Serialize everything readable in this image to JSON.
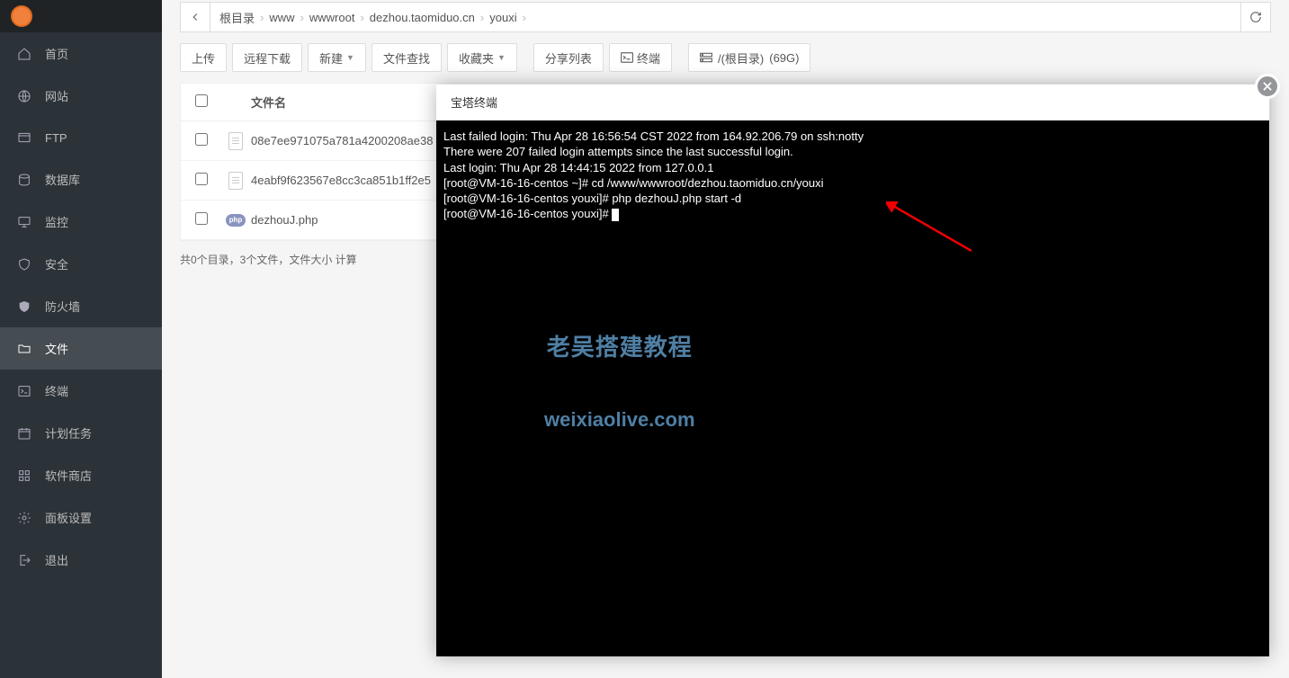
{
  "sidebar": {
    "server_name": "",
    "items": [
      {
        "label": "首页",
        "icon": "home"
      },
      {
        "label": "网站",
        "icon": "globe"
      },
      {
        "label": "FTP",
        "icon": "ftp"
      },
      {
        "label": "数据库",
        "icon": "database"
      },
      {
        "label": "监控",
        "icon": "monitor"
      },
      {
        "label": "安全",
        "icon": "shield"
      },
      {
        "label": "防火墙",
        "icon": "firewall"
      },
      {
        "label": "文件",
        "icon": "folder",
        "active": true
      },
      {
        "label": "终端",
        "icon": "terminal"
      },
      {
        "label": "计划任务",
        "icon": "schedule"
      },
      {
        "label": "软件商店",
        "icon": "apps"
      },
      {
        "label": "面板设置",
        "icon": "gear"
      },
      {
        "label": "退出",
        "icon": "logout"
      }
    ]
  },
  "breadcrumb": {
    "segments": [
      "根目录",
      "www",
      "wwwroot",
      "dezhou.taomiduo.cn",
      "youxi"
    ]
  },
  "toolbar": {
    "upload": "上传",
    "remote_download": "远程下载",
    "new": "新建",
    "find": "文件查找",
    "favorites": "收藏夹",
    "share_list": "分享列表",
    "terminal": "终端",
    "disk_root": "/(根目录)",
    "disk_free": "(69G)"
  },
  "filelist": {
    "header_name": "文件名",
    "rows": [
      {
        "type": "doc",
        "name": "08e7ee971075a781a4200208ae38"
      },
      {
        "type": "doc",
        "name": "4eabf9f623567e8cc3ca851b1ff2e5"
      },
      {
        "type": "php",
        "name": "dezhouJ.php"
      }
    ]
  },
  "footer": "共0个目录，3个文件，文件大小 计算",
  "modal": {
    "title": "宝塔终端",
    "terminal_lines": [
      "Last failed login: Thu Apr 28 16:56:54 CST 2022 from 164.92.206.79 on ssh:notty",
      "There were 207 failed login attempts since the last successful login.",
      "Last login: Thu Apr 28 14:44:15 2022 from 127.0.0.1",
      "[root@VM-16-16-centos ~]# cd /www/wwwroot/dezhou.taomiduo.cn/youxi",
      "[root@VM-16-16-centos youxi]# php dezhouJ.php start -d",
      "[root@VM-16-16-centos youxi]# "
    ],
    "watermark_line1": "老吴搭建教程",
    "watermark_line2": "weixiaolive.com"
  },
  "icons": {
    "php_label": "php"
  }
}
